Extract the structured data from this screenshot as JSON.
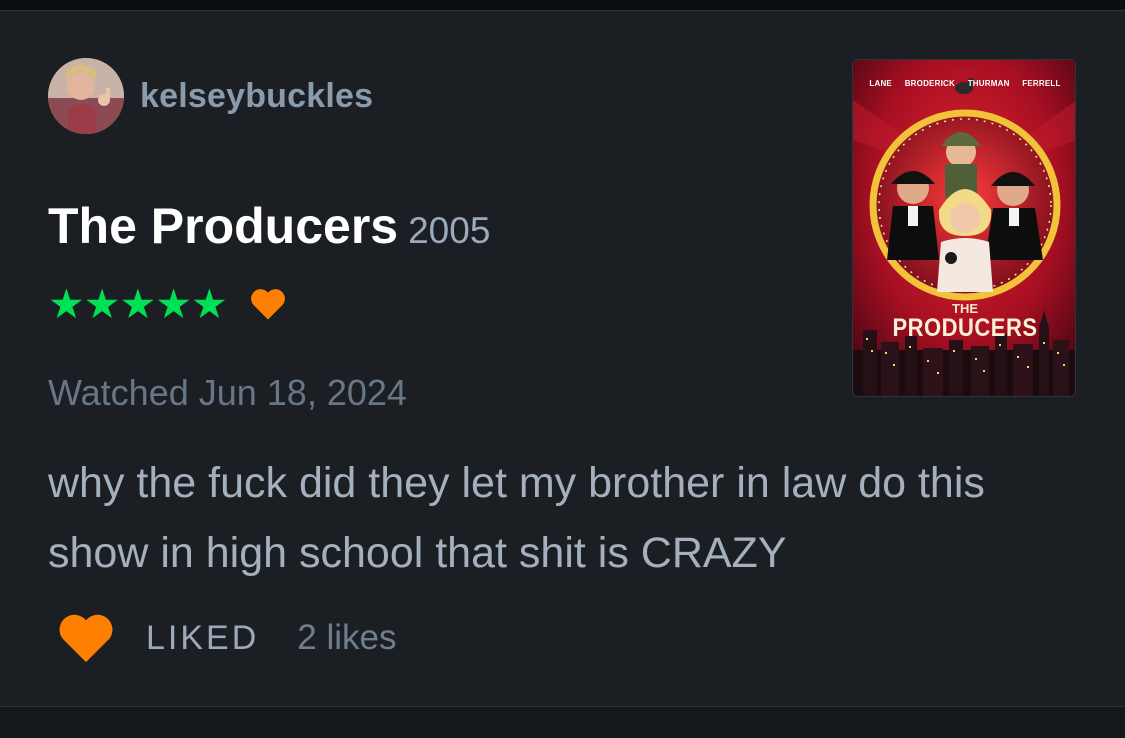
{
  "review": {
    "username": "kelseybuckles",
    "film_title": "The Producers",
    "film_year": "2005",
    "rating_stars": "★★★★★",
    "rating_value": 5,
    "rating_max": 5,
    "liked_film": true,
    "watched_text": "Watched Jun 18, 2024",
    "body": "why the fuck did they let my brother in law do this show in high school that shit is CRAZY",
    "like_label": "LIKED",
    "likes_count_text": "2 likes"
  },
  "poster": {
    "cast": [
      "LANE",
      "BRODERICK",
      "THURMAN",
      "FERRELL"
    ],
    "title_small": "THE",
    "title_big": "PRODUCERS"
  },
  "colors": {
    "background": "#14181c",
    "card": "#1b1f24",
    "star_green": "#00e054",
    "heart_orange": "#ff8000",
    "username": "#8a9bab",
    "muted_text": "#687786"
  },
  "icons": {
    "rating_heart": "heart-icon",
    "like_button": "heart-icon"
  }
}
